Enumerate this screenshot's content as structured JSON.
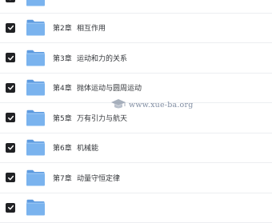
{
  "rows": [
    {
      "checked": true,
      "chapter": "",
      "title": ""
    },
    {
      "checked": true,
      "chapter": "第2章",
      "title": "相互作用"
    },
    {
      "checked": true,
      "chapter": "第3章",
      "title": "运动和力的关系"
    },
    {
      "checked": true,
      "chapter": "第4章",
      "title": "抛体运动与圆周运动"
    },
    {
      "checked": true,
      "chapter": "第5章",
      "title": "万有引力与航天"
    },
    {
      "checked": true,
      "chapter": "第6章",
      "title": "机械能"
    },
    {
      "checked": true,
      "chapter": "第7章",
      "title": "动量守恒定律"
    },
    {
      "checked": true,
      "chapter": "",
      "title": ""
    }
  ],
  "watermark": {
    "text": "www.xue-ba.org"
  },
  "colors": {
    "folder_front": "#7ab3ee",
    "folder_back": "#5d9be0",
    "checkbox": "#202124"
  },
  "icons": {
    "checkbox": "checkmark-icon",
    "folder": "folder-icon",
    "watermark": "graduation-cap-icon"
  }
}
